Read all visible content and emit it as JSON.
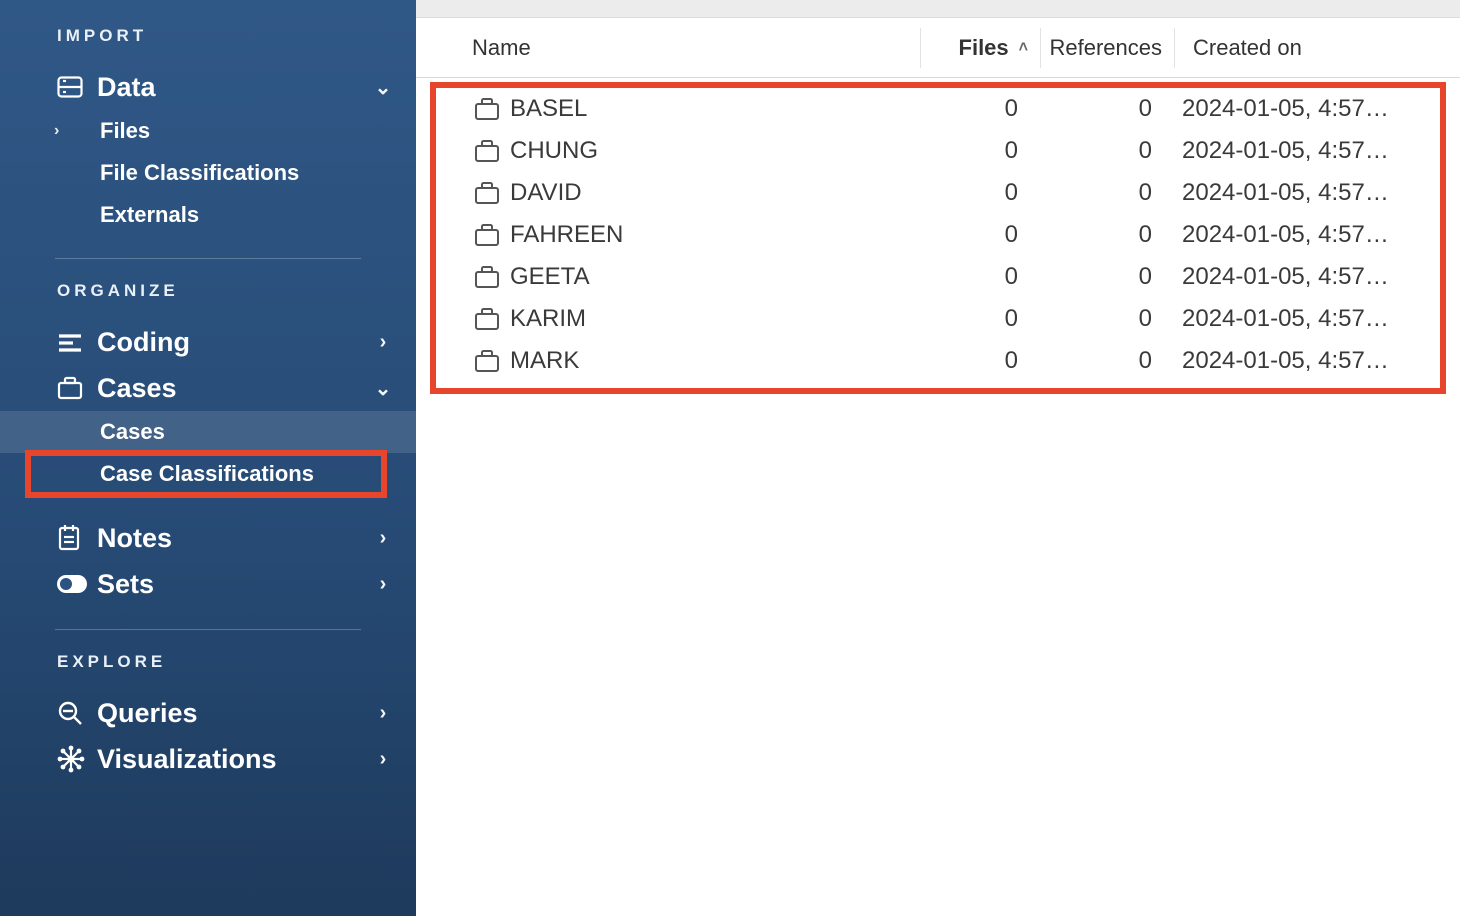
{
  "sidebar": {
    "sections": {
      "import": {
        "label": "IMPORT",
        "data": {
          "label": "Data",
          "children": {
            "files": "Files",
            "fileClassifications": "File Classifications",
            "externals": "Externals"
          }
        }
      },
      "organize": {
        "label": "ORGANIZE",
        "coding": {
          "label": "Coding"
        },
        "cases": {
          "label": "Cases",
          "children": {
            "cases": "Cases",
            "caseClassifications": "Case Classifications"
          }
        },
        "notes": {
          "label": "Notes"
        },
        "sets": {
          "label": "Sets"
        }
      },
      "explore": {
        "label": "EXPLORE",
        "queries": {
          "label": "Queries"
        },
        "visualizations": {
          "label": "Visualizations"
        }
      }
    }
  },
  "table": {
    "headers": {
      "name": "Name",
      "files": "Files",
      "references": "References",
      "created": "Created on"
    },
    "rows": [
      {
        "name": "BASEL",
        "files": "0",
        "refs": "0",
        "created": "2024-01-05, 4:57…"
      },
      {
        "name": "CHUNG",
        "files": "0",
        "refs": "0",
        "created": "2024-01-05, 4:57…"
      },
      {
        "name": "DAVID",
        "files": "0",
        "refs": "0",
        "created": "2024-01-05, 4:57…"
      },
      {
        "name": "FAHREEN",
        "files": "0",
        "refs": "0",
        "created": "2024-01-05, 4:57…"
      },
      {
        "name": "GEETA",
        "files": "0",
        "refs": "0",
        "created": "2024-01-05, 4:57…"
      },
      {
        "name": "KARIM",
        "files": "0",
        "refs": "0",
        "created": "2024-01-05, 4:57…"
      },
      {
        "name": "MARK",
        "files": "0",
        "refs": "0",
        "created": "2024-01-05, 4:57…"
      }
    ]
  }
}
